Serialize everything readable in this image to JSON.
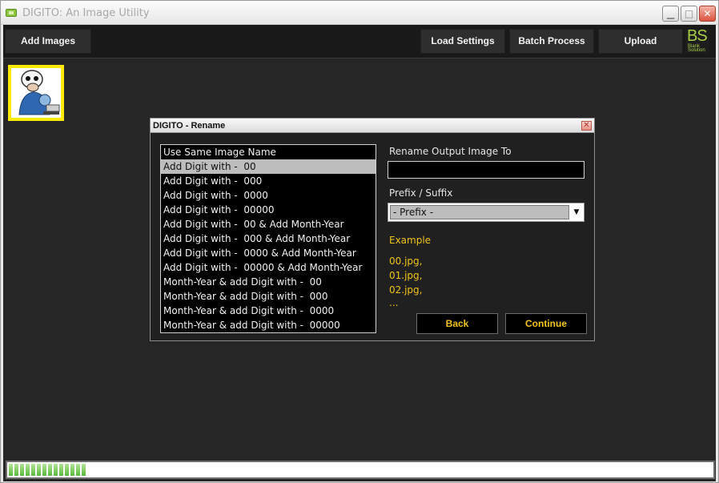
{
  "window": {
    "title": "DIGITO: An Image Utility",
    "minimize_glyph": "▁",
    "maximize_glyph": "□",
    "close_glyph": "✕"
  },
  "toolbar": {
    "add_images": "Add Images",
    "load_settings": "Load Settings",
    "batch_process": "Batch Process",
    "upload": "Upload",
    "logo_text": "BS",
    "logo_sub": "Blank Solution"
  },
  "dialog": {
    "title": "DIGITO - Rename",
    "close_glyph": "✕",
    "rename_label": "Rename Output Image To",
    "rename_value": "",
    "prefix_label": "Prefix / Suffix",
    "prefix_value": "- Prefix -",
    "dropdown_glyph": "▼",
    "example_title": "Example",
    "examples": [
      "00.jpg,",
      "01.jpg,",
      "02.jpg,",
      "..."
    ],
    "back": "Back",
    "continue": "Continue",
    "options": [
      "Use Same Image Name",
      "Add Digit with -  00",
      "Add Digit with -  000",
      "Add Digit with -  0000",
      "Add Digit with -  00000",
      "Add Digit with -  00 & Add Month-Year",
      "Add Digit with -  000 & Add Month-Year",
      "Add Digit with -  0000 & Add Month-Year",
      "Add Digit with -  00000 & Add Month-Year",
      "Month-Year & add Digit with -  00",
      "Month-Year & add Digit with -  000",
      "Month-Year & add Digit with -  0000",
      "Month-Year & add Digit with -  00000"
    ],
    "selected_index": 1
  },
  "progress": {
    "segments": 14
  },
  "colors": {
    "accent_yellow": "#f0c419",
    "logo_green": "#a9cf46",
    "thumb_border": "#ffea00",
    "client_bg": "#262626"
  }
}
